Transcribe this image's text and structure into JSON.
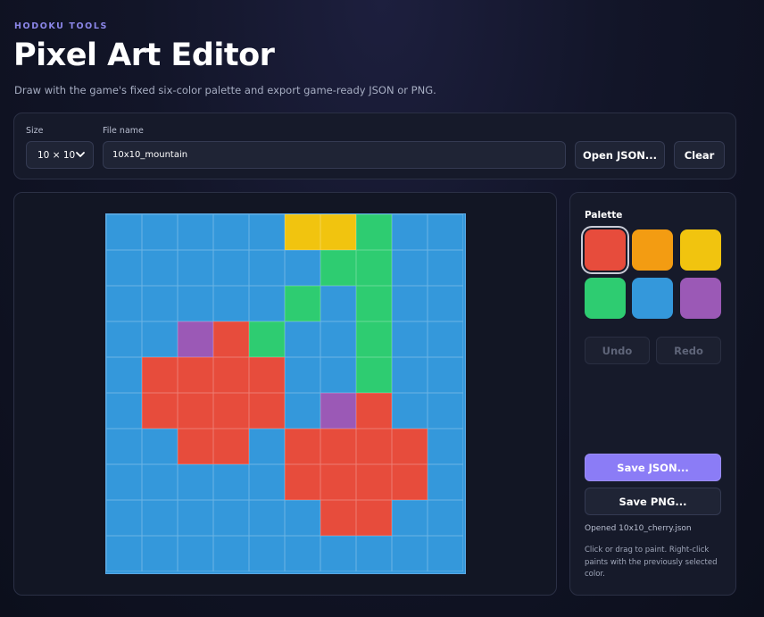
{
  "header": {
    "eyebrow": "HODOKU TOOLS",
    "title": "Pixel Art Editor",
    "subtitle": "Draw with the game's fixed six-color palette and export game-ready JSON or PNG."
  },
  "toolbar": {
    "size_label": "Size",
    "size_value": "10 × 10",
    "file_label": "File name",
    "file_value": "10x10_mountain",
    "open_label": "Open JSON...",
    "clear_label": "Clear"
  },
  "palette": {
    "label": "Palette",
    "selected": 0,
    "colors": [
      "#e74c3c",
      "#f39c12",
      "#f1c40f",
      "#2ecc71",
      "#3498db",
      "#9b59b6"
    ],
    "color_names": [
      "red",
      "orange",
      "yellow",
      "green",
      "blue",
      "purple"
    ]
  },
  "grid": {
    "size": 10,
    "rows": [
      [
        4,
        4,
        4,
        4,
        4,
        2,
        2,
        3,
        4,
        4
      ],
      [
        4,
        4,
        4,
        4,
        4,
        4,
        3,
        3,
        4,
        4
      ],
      [
        4,
        4,
        4,
        4,
        4,
        3,
        4,
        3,
        4,
        4
      ],
      [
        4,
        4,
        5,
        0,
        3,
        4,
        4,
        3,
        4,
        4
      ],
      [
        4,
        0,
        0,
        0,
        0,
        4,
        4,
        3,
        4,
        4
      ],
      [
        4,
        0,
        0,
        0,
        0,
        4,
        5,
        0,
        4,
        4
      ],
      [
        4,
        4,
        0,
        0,
        4,
        0,
        0,
        0,
        0,
        4
      ],
      [
        4,
        4,
        4,
        4,
        4,
        0,
        0,
        0,
        0,
        4
      ],
      [
        4,
        4,
        4,
        4,
        4,
        4,
        0,
        0,
        4,
        4
      ],
      [
        4,
        4,
        4,
        4,
        4,
        4,
        4,
        4,
        4,
        4
      ]
    ]
  },
  "actions": {
    "undo_label": "Undo",
    "redo_label": "Redo",
    "save_json_label": "Save JSON...",
    "save_png_label": "Save PNG..."
  },
  "status": "Opened 10x10_cherry.json",
  "hint": "Click or drag to paint. Right-click paints with the previously selected color."
}
